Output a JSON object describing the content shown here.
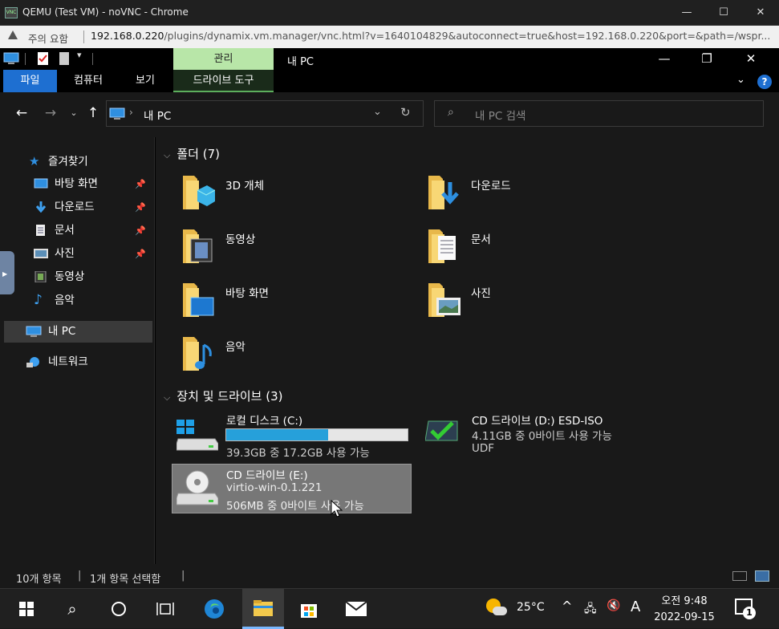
{
  "browser": {
    "title": "QEMU (Test VM) - noVNC - Chrome",
    "vnc_badge": "VNC",
    "minimize": "—",
    "maximize": "☐",
    "close": "✕",
    "security_label": "주의 요함",
    "url_host": "192.168.0.220",
    "url_rest": "/plugins/dynamix.vm.manager/vnc.html?v=1640104829&autoconnect=true&host=192.168.0.220&port=&path=/wspr..."
  },
  "explorer": {
    "manage_tab": "관리",
    "window_title": "내 PC",
    "tabs": [
      "파일",
      "컴퓨터",
      "보기",
      "드라이브 도구"
    ],
    "path": [
      "내 PC"
    ],
    "search_placeholder": "내 PC 검색",
    "sidebar": {
      "quick_access": "즐겨찾기",
      "quick_items": [
        {
          "label": "바탕 화면",
          "pinned": true
        },
        {
          "label": "다운로드",
          "pinned": true
        },
        {
          "label": "문서",
          "pinned": true
        },
        {
          "label": "사진",
          "pinned": true
        },
        {
          "label": "동영상",
          "pinned": false
        },
        {
          "label": "음악",
          "pinned": false
        }
      ],
      "this_pc": "내 PC",
      "network": "네트워크"
    },
    "folders_header": "폴더 (7)",
    "folders": [
      "3D 개체",
      "다운로드",
      "동영상",
      "문서",
      "바탕 화면",
      "사진",
      "음악"
    ],
    "drives_header": "장치 및 드라이브 (3)",
    "drives": [
      {
        "name": "로컬 디스크 (C:)",
        "detail": "39.3GB 중 17.2GB 사용 가능",
        "used_fraction": 0.56
      },
      {
        "name": "CD 드라이브 (D:) ESD-ISO",
        "detail": "4.11GB 중 0바이트 사용 가능",
        "extra": "UDF"
      },
      {
        "name": "CD 드라이브 (E:)",
        "detail": "virtio-win-0.1.221",
        "extra": "506MB 중 0바이트 사용 가능"
      }
    ],
    "status": {
      "count": "10개 항목",
      "selected": "1개 항목 선택함"
    }
  },
  "taskbar": {
    "weather": "25°C",
    "ime": "A",
    "time": "오전 9:48",
    "date": "2022-09-15",
    "notifications": "1"
  },
  "colors": {
    "accent": "#1e6fd1",
    "manage_tab": "#b8e6a8",
    "drive_bar": "#26a0da",
    "selected": "#777777"
  }
}
